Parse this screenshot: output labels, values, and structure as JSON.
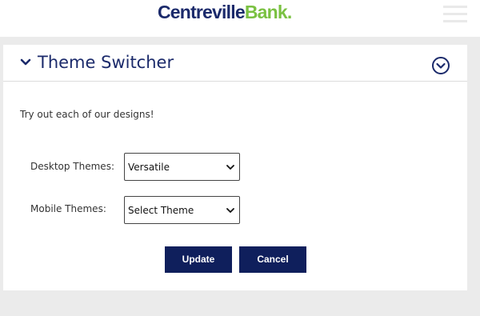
{
  "header": {
    "logo_part1": "Centreville",
    "logo_part2": "Bank."
  },
  "panel": {
    "title": "Theme Switcher",
    "intro": "Try out each of our designs!",
    "desktop": {
      "label": "Desktop Themes:",
      "value": "Versatile"
    },
    "mobile": {
      "label": "Mobile Themes:",
      "value": "Select Theme"
    },
    "update_label": "Update",
    "cancel_label": "Cancel"
  },
  "colors": {
    "brand_navy": "#1b2a6b",
    "brand_green": "#7ac142",
    "button_bg": "#0f1f5c"
  }
}
